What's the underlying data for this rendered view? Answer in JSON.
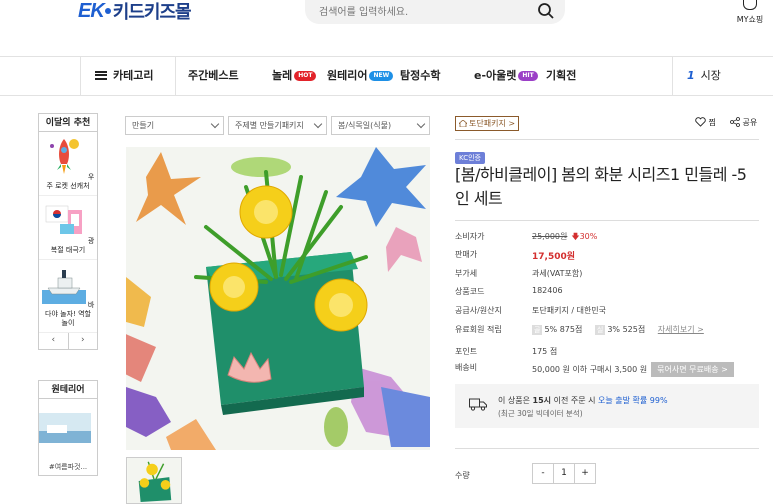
{
  "header": {
    "logo_mark": "EK",
    "logo_name": "키드키즈몰",
    "search_placeholder": "검색어를 입력하세요.",
    "my_shop": "MY쇼핑"
  },
  "nav": {
    "category": "카테고리",
    "items": [
      {
        "label": "주간베스트",
        "badge": ""
      },
      {
        "label": "놀레",
        "badge": "HOT"
      },
      {
        "label": "원테리어",
        "badge": "NEW"
      },
      {
        "label": "탐정수학",
        "badge": ""
      },
      {
        "label": "e-아울렛",
        "badge": "HIT"
      },
      {
        "label": "기획전",
        "badge": ""
      }
    ],
    "rank_num": "1",
    "rank_label": "시장"
  },
  "sidebar": {
    "title": "이달의 추천",
    "products": [
      {
        "name": "우주 로켓 선캐처",
        "icon": "rocket-icon"
      },
      {
        "name": "광복절 태극기",
        "icon": "flag-icon"
      },
      {
        "name": "바다야 놀자! 역할 놀이",
        "icon": "ship-icon"
      }
    ],
    "prev": "‹",
    "next": "›",
    "section2_title": "원테리어",
    "section2_caption": "#여름파것..."
  },
  "breadcrumb": {
    "level1": "만들기",
    "level2": "주제별 만들기패키지",
    "level3": "봄/식목일(식물)"
  },
  "product": {
    "store_label": "토단패키지 >",
    "wish_label": "찜",
    "share_label": "공유",
    "tag": "KC인증",
    "title": "[봄/하비클레이] 봄의 화분 시리즈1 민들레 -5인 세트",
    "rows": {
      "consumer_label": "소비자가",
      "consumer_price": "25,000원",
      "discount": "30%",
      "sale_label": "판매가",
      "sale_price": "17,500원",
      "vat_label": "부가세",
      "vat_value": "과세(VAT포함)",
      "code_label": "상품코드",
      "code_value": "182406",
      "supplier_label": "공급사/원산지",
      "supplier_value": "토단패키지 / 대한민국",
      "member_label": "유료회원 적립",
      "member_chip1": "5%",
      "member_points1": "875점",
      "member_chip2": "3%",
      "member_points2": "525점",
      "member_link": "자세히보기 >",
      "point_label": "포인트",
      "point_value": "175 점",
      "ship_label": "배송비",
      "ship_value": "50,000 원 이하 구매시 3,500 원",
      "ship_button": "묶어사면 무료배송 >"
    },
    "notice_line1_a": "이 상품은",
    "notice_line1_b": "15시",
    "notice_line1_c": "이전 주문 시",
    "notice_line1_d": "오늘 출발 확률 99%",
    "notice_line2": "(최근 30일 빅데이터 분석)",
    "qty_label": "수량",
    "qty_minus": "-",
    "qty_value": "1",
    "qty_plus": "+"
  },
  "colors": {
    "brand_blue": "#1e5fd1",
    "price_red": "#d32f2f",
    "badge_hot": "#e2232a",
    "badge_new": "#1e90e6",
    "badge_hit": "#9b3fc7",
    "pot_green": "#1f8f6a",
    "flower_yellow": "#f5cf1a"
  }
}
